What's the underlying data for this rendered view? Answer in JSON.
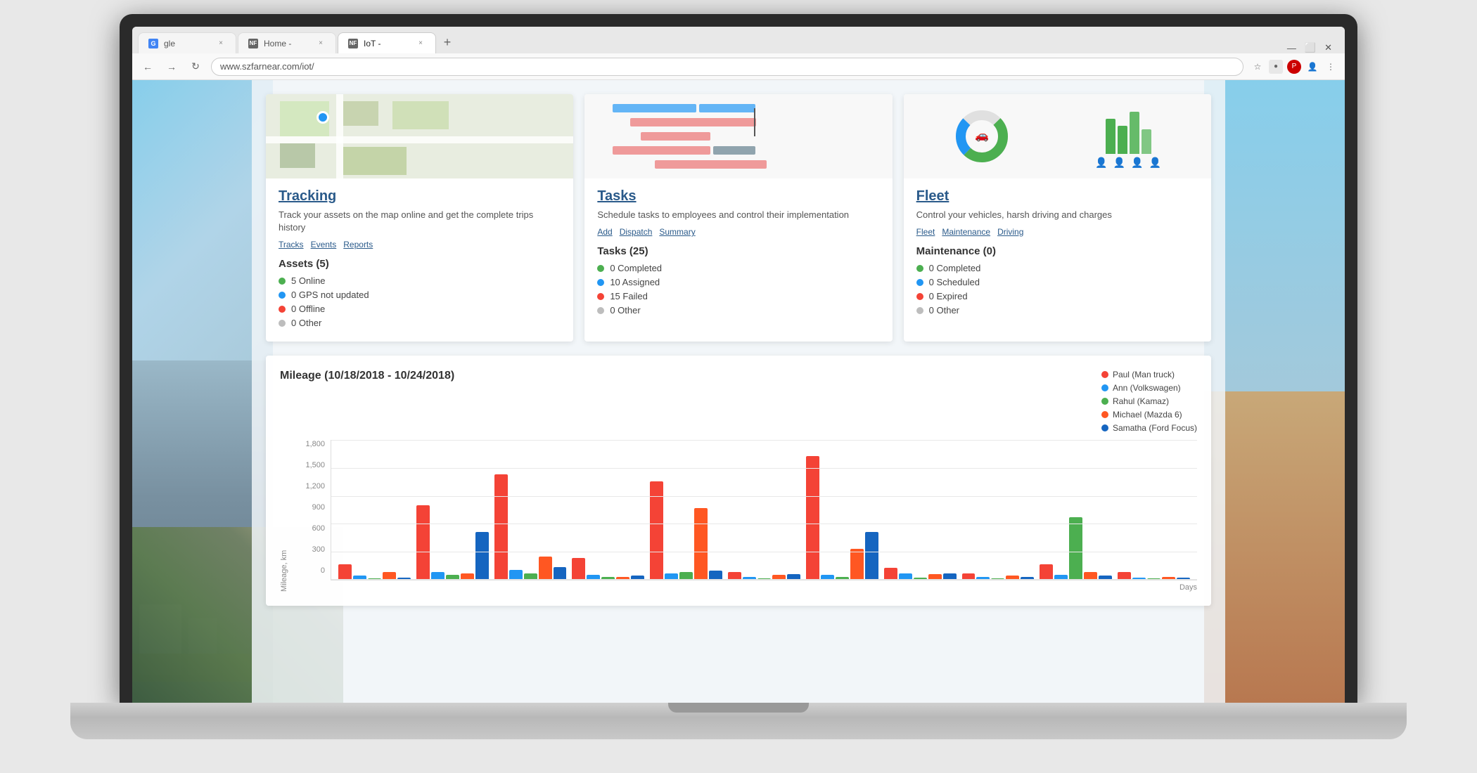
{
  "browser": {
    "tabs": [
      {
        "label": "gle",
        "active": false,
        "favicon": "G"
      },
      {
        "label": "Home -",
        "active": false,
        "favicon": "N"
      },
      {
        "label": "IoT -",
        "active": true,
        "favicon": "N"
      }
    ],
    "url": "www.szfarnear.com/iot/",
    "nav_reload": "↻",
    "nav_back": "←",
    "nav_forward": "→"
  },
  "cards": [
    {
      "id": "tracking",
      "title": "Tracking",
      "description": "Track your assets on the map online and get the complete trips history",
      "links": [
        "Tracks",
        "Events",
        "Reports"
      ],
      "stat_title": "Assets (5)",
      "stats": [
        {
          "label": "5 Online",
          "color": "#4CAF50"
        },
        {
          "label": "0 GPS not updated",
          "color": "#2196F3"
        },
        {
          "label": "0 Offline",
          "color": "#f44336"
        },
        {
          "label": "0 Other",
          "color": "#bdbdbd"
        }
      ]
    },
    {
      "id": "tasks",
      "title": "Tasks",
      "description": "Schedule tasks to employees and control their implementation",
      "links": [
        "Add",
        "Dispatch",
        "Summary"
      ],
      "stat_title": "Tasks (25)",
      "stats": [
        {
          "label": "0 Completed",
          "color": "#4CAF50"
        },
        {
          "label": "10 Assigned",
          "color": "#2196F3"
        },
        {
          "label": "15 Failed",
          "color": "#f44336"
        },
        {
          "label": "0 Other",
          "color": "#bdbdbd"
        }
      ]
    },
    {
      "id": "fleet",
      "title": "Fleet",
      "description": "Control your vehicles, harsh driving and charges",
      "links": [
        "Fleet",
        "Maintenance",
        "Driving"
      ],
      "stat_title": "Maintenance (0)",
      "stats": [
        {
          "label": "0 Completed",
          "color": "#4CAF50"
        },
        {
          "label": "0 Scheduled",
          "color": "#2196F3"
        },
        {
          "label": "0 Expired",
          "color": "#f44336"
        },
        {
          "label": "0 Other",
          "color": "#bdbdbd"
        }
      ]
    }
  ],
  "chart": {
    "title": "Mileage (10/18/2018 - 10/24/2018)",
    "y_label": "Mileage, km",
    "x_label": "Days",
    "y_ticks": [
      "1,800",
      "1,500",
      "1,200",
      "900",
      "600",
      "300",
      "0"
    ],
    "legend": [
      {
        "label": "Paul (Man truck)",
        "color": "#f44336"
      },
      {
        "label": "Ann (Volkswagen)",
        "color": "#2196F3"
      },
      {
        "label": "Rahul (Kamaz)",
        "color": "#4CAF50"
      },
      {
        "label": "Michael (Mazda 6)",
        "color": "#FF5722"
      },
      {
        "label": "Samatha (Ford Focus)",
        "color": "#1565C0"
      }
    ],
    "bar_groups": [
      {
        "bars": [
          200,
          50,
          20,
          100,
          30
        ]
      },
      {
        "bars": [
          950,
          100,
          60,
          80,
          610
        ]
      },
      {
        "bars": [
          1350,
          130,
          80,
          300,
          160
        ]
      },
      {
        "bars": [
          280,
          60,
          40,
          40,
          50
        ]
      },
      {
        "bars": [
          1260,
          80,
          100,
          920,
          120
        ]
      },
      {
        "bars": [
          100,
          40,
          20,
          60,
          70
        ]
      },
      {
        "bars": [
          1580,
          60,
          40,
          400,
          610
        ]
      },
      {
        "bars": [
          150,
          80,
          30,
          70,
          80
        ]
      },
      {
        "bars": [
          80,
          40,
          20,
          50,
          40
        ]
      },
      {
        "bars": [
          200,
          60,
          800,
          100,
          50
        ]
      },
      {
        "bars": [
          100,
          30,
          20,
          40,
          30
        ]
      }
    ]
  }
}
